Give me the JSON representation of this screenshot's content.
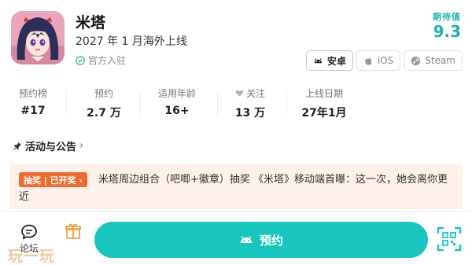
{
  "game": {
    "title": "米塔",
    "release": "2027 年 1 月海外上线",
    "official": "官方入驻"
  },
  "rating": {
    "label": "期待值",
    "value": "9.3"
  },
  "platforms": [
    {
      "label": "安卓",
      "icon": "android-icon",
      "active": true
    },
    {
      "label": "iOS",
      "icon": "apple-icon",
      "active": false
    },
    {
      "label": "Steam",
      "icon": "steam-icon",
      "active": false
    }
  ],
  "stats": [
    {
      "label": "预约榜",
      "value": "#17"
    },
    {
      "label": "预约",
      "value": "2.7 万"
    },
    {
      "label": "适用年龄",
      "value": "16+"
    },
    {
      "label": "关注",
      "value": "13 万",
      "icon": "heart-icon"
    },
    {
      "label": "上线日期",
      "value": "27年1月"
    }
  ],
  "events": {
    "title": "活动与公告",
    "badge": "抽奖 | 已开奖 ›",
    "text": "米塔周边组合（吧唧+徽章）抽奖 《米塔》移动端首曝：这一次，她会离你更近"
  },
  "bottom": {
    "forum_label": "论坛",
    "reserve_label": "预约",
    "watermark": "玩一玩"
  },
  "colors": {
    "accent": "#18c6bd",
    "rating": "#17b5ad",
    "badge": "#ef6a2c",
    "event_bg": "#fdf1ea"
  }
}
